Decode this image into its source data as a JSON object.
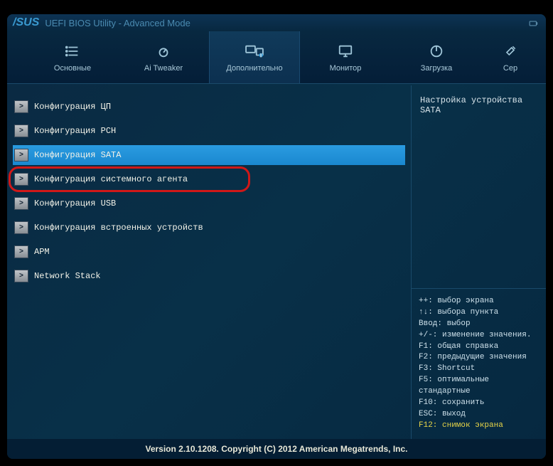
{
  "brand": "/SUS",
  "title": "UEFI BIOS Utility - Advanced Mode",
  "tabs": [
    {
      "label": "Основные",
      "icon": "list"
    },
    {
      "label": "Ai Tweaker",
      "icon": "dial"
    },
    {
      "label": "Дополнительно",
      "icon": "devices"
    },
    {
      "label": "Монитор",
      "icon": "monitor"
    },
    {
      "label": "Загрузка",
      "icon": "power"
    },
    {
      "label": "Сер",
      "icon": "tool"
    }
  ],
  "active_tab": 2,
  "menu": [
    {
      "label": "Конфигурация ЦП"
    },
    {
      "label": "Конфигурация PCH"
    },
    {
      "label": "Конфигурация SATA",
      "selected": true
    },
    {
      "label": "Конфигурация системного агента",
      "callout": true
    },
    {
      "label": "Конфигурация USB"
    },
    {
      "label": "Конфигурация встроенных устройств"
    },
    {
      "label": "APM"
    },
    {
      "label": "Network Stack"
    }
  ],
  "help_title": "Настройка устройства SATA",
  "shortcuts": [
    "++: выбор экрана",
    "↑↓: выбора пункта",
    "Ввод: выбор",
    "+/-: изменение значения.",
    "F1: общая справка",
    "F2: предыдущие значения",
    "F3: Shortcut",
    "F5: оптимальные стандартные",
    "F10: сохранить",
    "ESC: выход"
  ],
  "shortcut_highlight": "F12: снимок экрана",
  "footer": "Version 2.10.1208. Copyright (C) 2012 American Megatrends, Inc."
}
